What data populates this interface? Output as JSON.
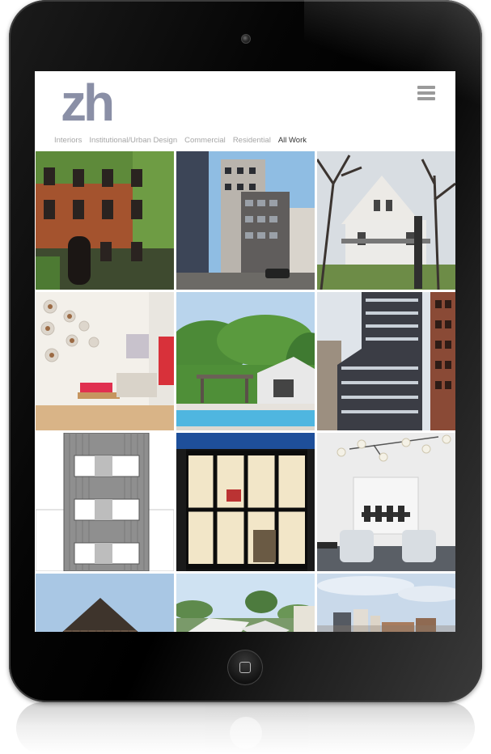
{
  "logo": "zh",
  "nav": {
    "items": [
      "Interiors",
      "Institutional/Urban Design",
      "Commercial",
      "Residential",
      "All Work"
    ],
    "active_index": 4
  },
  "icons": {
    "menu": "hamburger-menu-icon",
    "camera": "camera-icon",
    "home": "home-button-icon"
  },
  "colors": {
    "logo": "#8a8fa6",
    "nav_text": "#a6a6a6",
    "nav_active": "#333333",
    "device_body": "#000000"
  },
  "gallery": {
    "tiles": [
      {
        "subject": "brick-townhouse"
      },
      {
        "subject": "modern-apartment-building"
      },
      {
        "subject": "white-suburban-house"
      },
      {
        "subject": "interior-wall-portraits-bench"
      },
      {
        "subject": "pool-house"
      },
      {
        "subject": "dark-tower-building"
      },
      {
        "subject": "elevation-drawing"
      },
      {
        "subject": "glass-facade-night"
      },
      {
        "subject": "white-dining-interior"
      },
      {
        "subject": "wood-barn-house"
      },
      {
        "subject": "tropical-roofs"
      },
      {
        "subject": "city-skyline"
      }
    ]
  }
}
